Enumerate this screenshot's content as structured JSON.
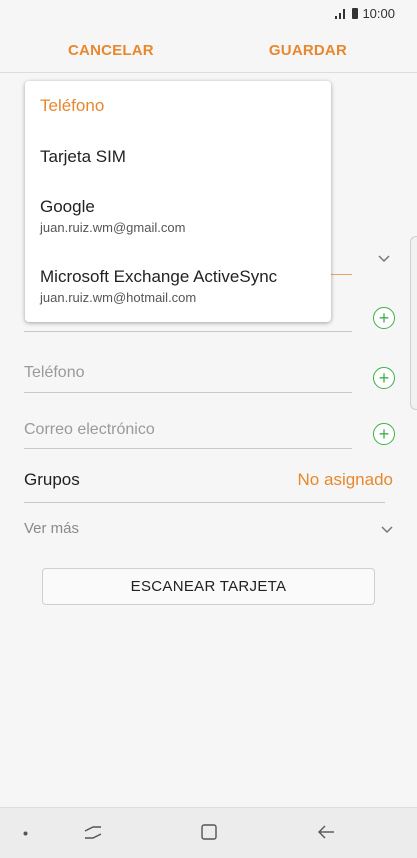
{
  "status": {
    "time": "10:00"
  },
  "topbar": {
    "cancel_label": "CANCELAR",
    "save_label": "GUARDAR"
  },
  "menu": {
    "items": [
      {
        "title": "Teléfono",
        "subtitle": "",
        "selected": true
      },
      {
        "title": "Tarjeta SIM",
        "subtitle": ""
      },
      {
        "title": "Google",
        "subtitle": "juan.ruiz.wm@gmail.com"
      },
      {
        "title": "Microsoft Exchange ActiveSync",
        "subtitle": "juan.ruiz.wm@hotmail.com"
      }
    ]
  },
  "form": {
    "phone_placeholder": "Teléfono",
    "email_placeholder": "Correo electrónico",
    "groups_label": "Grupos",
    "groups_value": "No asignado",
    "more_label": "Ver más",
    "scan_label": "ESCANEAR TARJETA"
  },
  "colors": {
    "accent": "#e8882e",
    "add": "#3fae49"
  },
  "icons": [
    "signal-icon",
    "battery-icon",
    "chevron-down-icon",
    "add-icon",
    "recent-apps-icon",
    "home-icon",
    "back-icon"
  ]
}
